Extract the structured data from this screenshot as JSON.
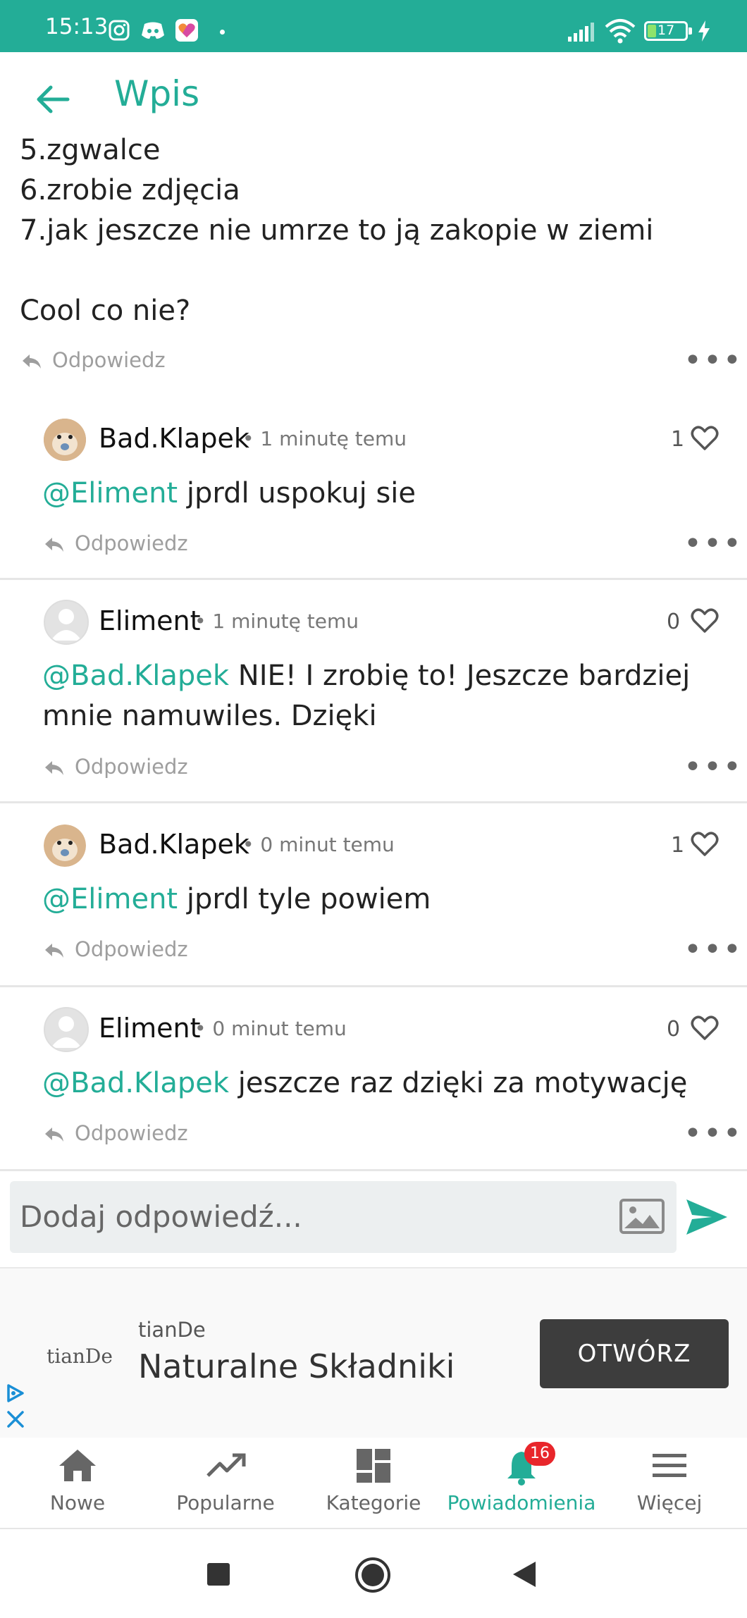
{
  "status_bar": {
    "time": "15:13",
    "battery": "17",
    "icons": [
      "instagram-icon",
      "discord-icon",
      "app-heart-icon",
      "signal-icon",
      "wifi-icon",
      "battery-icon",
      "charging-icon"
    ]
  },
  "header": {
    "title": "Wpis",
    "back_icon": "arrow-left-icon"
  },
  "post": {
    "lines": [
      "5.zgwalce",
      "6.zrobie zdjęcia",
      "7.jak jeszcze nie umrze to ją zakopie w ziemi",
      "Cool co nie?"
    ],
    "reply_label": "Odpowiedz"
  },
  "comments": [
    {
      "author": "Bad.Klapek",
      "time": "1 minutę temu",
      "likes": "1",
      "mention": "@Eliment",
      "text": " jprdl uspokuj sie",
      "reply_label": "Odpowiedz",
      "avatar": "hamster-avatar"
    },
    {
      "author": "Eliment",
      "time": "1 minutę temu",
      "likes": "0",
      "mention": "@Bad.Klapek",
      "text_line1": " NIE! I zrobię to! Jeszcze bardziej",
      "text_line2": "mnie namuwiles. Dzięki",
      "reply_label": "Odpowiedz",
      "avatar": "default-avatar"
    },
    {
      "author": "Bad.Klapek",
      "time": "0 minut temu",
      "likes": "1",
      "mention": "@Eliment",
      "text": " jprdl tyle powiem",
      "reply_label": "Odpowiedz",
      "avatar": "hamster-avatar"
    },
    {
      "author": "Eliment",
      "time": "0 minut temu",
      "likes": "0",
      "mention": "@Bad.Klapek",
      "text": " jeszcze raz dzięki za motywację",
      "reply_label": "Odpowiedz",
      "avatar": "default-avatar"
    }
  ],
  "reply_input": {
    "placeholder": "Dodaj odpowiedź..."
  },
  "ad": {
    "logo_text": "tianDe",
    "advertiser": "tianDe",
    "headline": "Naturalne Składniki",
    "button_label": "OTWÓRZ"
  },
  "bottom_nav": {
    "items": [
      {
        "label": "Nowe",
        "icon": "home-icon"
      },
      {
        "label": "Popularne",
        "icon": "trending-icon"
      },
      {
        "label": "Kategorie",
        "icon": "grid-icon"
      },
      {
        "label": "Powiadomienia",
        "icon": "bell-icon",
        "badge": "16",
        "active": true
      },
      {
        "label": "Więcej",
        "icon": "menu-icon"
      }
    ]
  },
  "colors": {
    "accent": "#23ad97",
    "badge": "#e8262b",
    "ad_button": "#3d3d3d"
  }
}
